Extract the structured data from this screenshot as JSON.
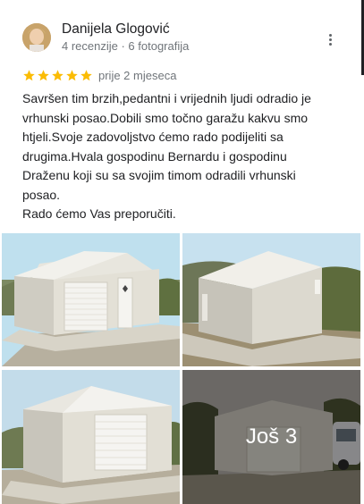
{
  "reviewer": {
    "name": "Danijela Glogović",
    "meta": "4 recenzije · 6 fotografija"
  },
  "review": {
    "rating": 5,
    "max_rating": 5,
    "date": "prije 2 mjeseca",
    "text": "Savršen tim brzih,pedantni i vrijednih ljudi odradio je\nvrhunski posao.Dobili smo točno garažu kakvu smo\nhtjeli.Svoje zadovoljstvo ćemo rado podijeliti sa\ndrugima.Hvala gospodinu Bernardu i gospodinu\nDraženu koji su sa svojim timom odradili vrhunski\nposao.\nRado ćemo Vas preporučiti."
  },
  "photos": {
    "more_label": "Još 3"
  },
  "colors": {
    "star": "#fbbc04",
    "muted_text": "#70757a"
  }
}
